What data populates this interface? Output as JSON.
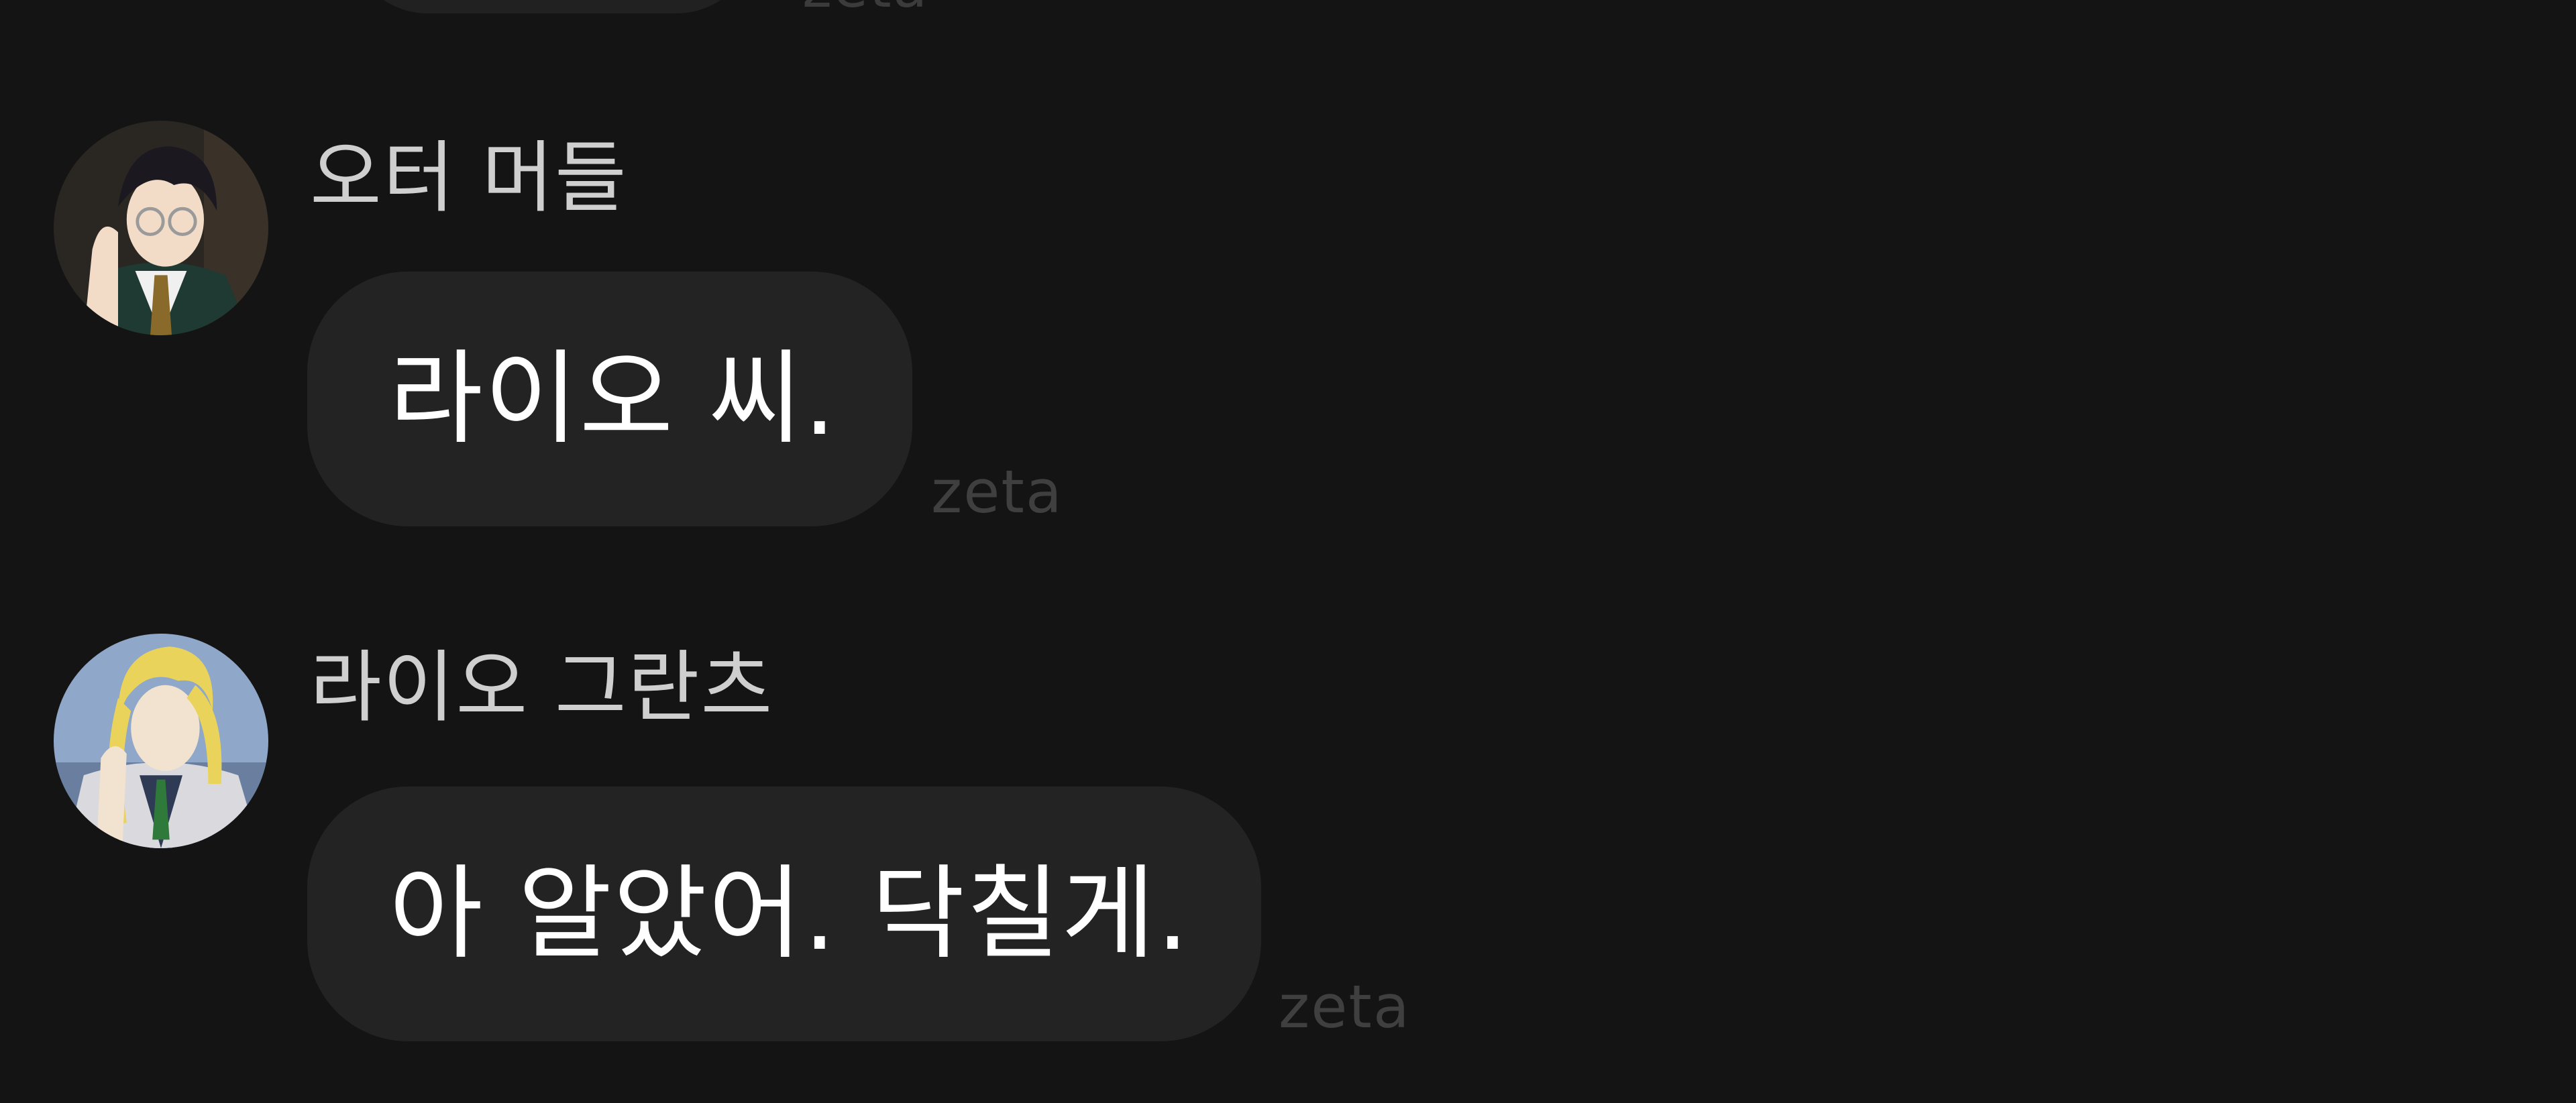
{
  "previous_message": {
    "watermark": "zeta"
  },
  "messages": [
    {
      "sender": "오터 머들",
      "text": "라이오 씨.",
      "watermark": "zeta"
    },
    {
      "sender": "라이오 그란츠",
      "text": "아 알았어. 닥칠게.",
      "watermark": "zeta"
    }
  ],
  "colors": {
    "background": "#141414",
    "bubble": "#232323",
    "sender_text": "#cfcfcf",
    "message_text": "#ffffff",
    "watermark": "#3f3f3f"
  }
}
